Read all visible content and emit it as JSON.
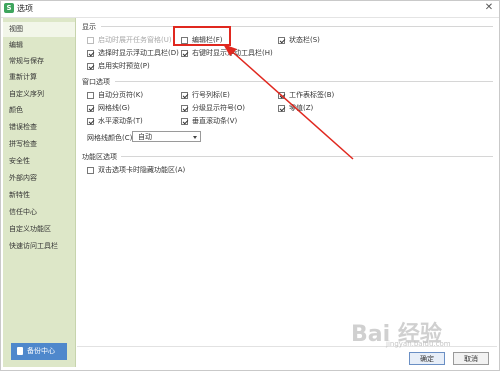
{
  "window": {
    "title": "选项",
    "close_glyph": "✕"
  },
  "sidebar": {
    "items": [
      "视图",
      "编辑",
      "常规与保存",
      "重新计算",
      "自定义序列",
      "颜色",
      "错误检查",
      "拼写检查",
      "安全性",
      "外部内容",
      "新特性",
      "信任中心",
      "自定义功能区",
      "快速访问工具栏"
    ],
    "backup_label": "备份中心"
  },
  "display": {
    "title": "显示",
    "options": [
      {
        "label": "启动时展开任务窗格(U)",
        "checked": false,
        "disabled": true
      },
      {
        "label": "编辑栏(F)",
        "checked": false
      },
      {
        "label": "状态栏(S)",
        "checked": true
      },
      {
        "label": "选择时显示浮动工具栏(D)",
        "checked": true
      },
      {
        "label": "右键时显示浮动工具栏(H)",
        "checked": true
      },
      {
        "label": "启用实时预览(P)",
        "checked": true
      }
    ]
  },
  "window_options": {
    "title": "窗口选项",
    "options": [
      {
        "label": "自动分页符(K)",
        "checked": false
      },
      {
        "label": "行号列标(E)",
        "checked": true
      },
      {
        "label": "工作表标签(B)",
        "checked": true
      },
      {
        "label": "网格线(G)",
        "checked": true
      },
      {
        "label": "分级显示符号(O)",
        "checked": true
      },
      {
        "label": "零值(Z)",
        "checked": true
      },
      {
        "label": "水平滚动条(T)",
        "checked": true
      },
      {
        "label": "垂直滚动条(V)",
        "checked": true
      }
    ],
    "gridline_color_label": "网格线颜色(C):",
    "gridline_color_value": "自动"
  },
  "ribbon": {
    "title": "功能区选项",
    "options": [
      {
        "label": "双击选项卡时隐藏功能区(A)",
        "checked": false
      }
    ]
  },
  "buttons": {
    "ok": "确定",
    "cancel": "取消"
  },
  "watermark": {
    "main": "Bai 经验",
    "sub": "jingyan.baidu.com"
  },
  "colors": {
    "sidebar": "#dde7c8",
    "highlight": "#e0281f",
    "backup": "#4f88cc"
  }
}
